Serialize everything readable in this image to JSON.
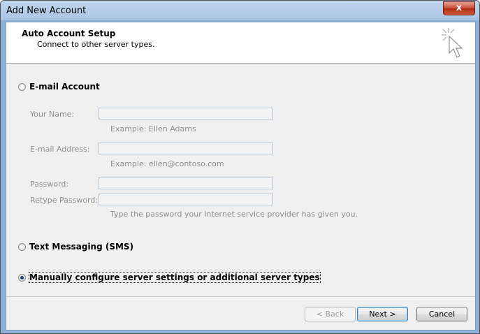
{
  "window": {
    "title": "Add New Account",
    "close_glyph": "x"
  },
  "header": {
    "title": "Auto Account Setup",
    "subtitle": "Connect to other server types."
  },
  "options": {
    "email": {
      "label": "E-mail Account",
      "selected": false
    },
    "sms": {
      "label": "Text Messaging (SMS)",
      "selected": false
    },
    "manual": {
      "label": "Manually configure server settings or additional server types",
      "selected": true
    }
  },
  "form": {
    "your_name": {
      "label": "Your Name:",
      "value": "",
      "hint": "Example: Ellen Adams"
    },
    "email_address": {
      "label": "E-mail Address:",
      "value": "",
      "hint": "Example: ellen@contoso.com"
    },
    "password": {
      "label": "Password:",
      "value": ""
    },
    "retype_password": {
      "label": "Retype Password:",
      "value": "",
      "hint": "Type the password your Internet service provider has given you."
    }
  },
  "buttons": {
    "back": "< Back",
    "next": "Next >",
    "cancel": "Cancel"
  }
}
